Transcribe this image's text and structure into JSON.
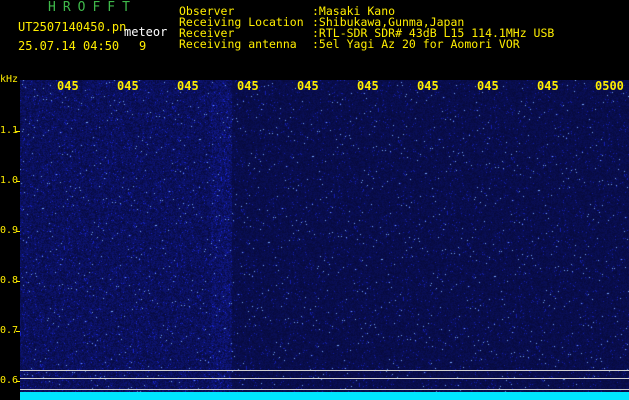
{
  "header": {
    "title_letters": "HROFFT",
    "filename": "UT2507140450.pn",
    "mode": "meteor",
    "datetime": "25.07.14 04:50",
    "count": "9"
  },
  "info": {
    "labels": [
      "Observer",
      "Receiving Location",
      "Receiver",
      "Receiving antenna"
    ],
    "values": [
      ":Masaki Kano",
      ":Shibukawa,Gunma,Japan",
      ":RTL-SDR SDR# 43dB L15 114.1MHz USB",
      ":5el Yagi Az 20 for Aomori VOR"
    ]
  },
  "axis": {
    "y_unit": "kHz",
    "y_ticks": [
      "1.1",
      "1.0",
      "0.9",
      "0.8",
      "0.7",
      "0.6"
    ],
    "x_ticks": [
      "045",
      "045",
      "045",
      "045",
      "045",
      "045",
      "045",
      "045",
      "045",
      "0500"
    ]
  },
  "colors": {
    "background": "#000000",
    "accent_yellow": "#ffee00",
    "title_green": "#3fb94a",
    "spectrum_blue": "#1a2a9e",
    "baseline_cyan": "#00e5ff"
  }
}
